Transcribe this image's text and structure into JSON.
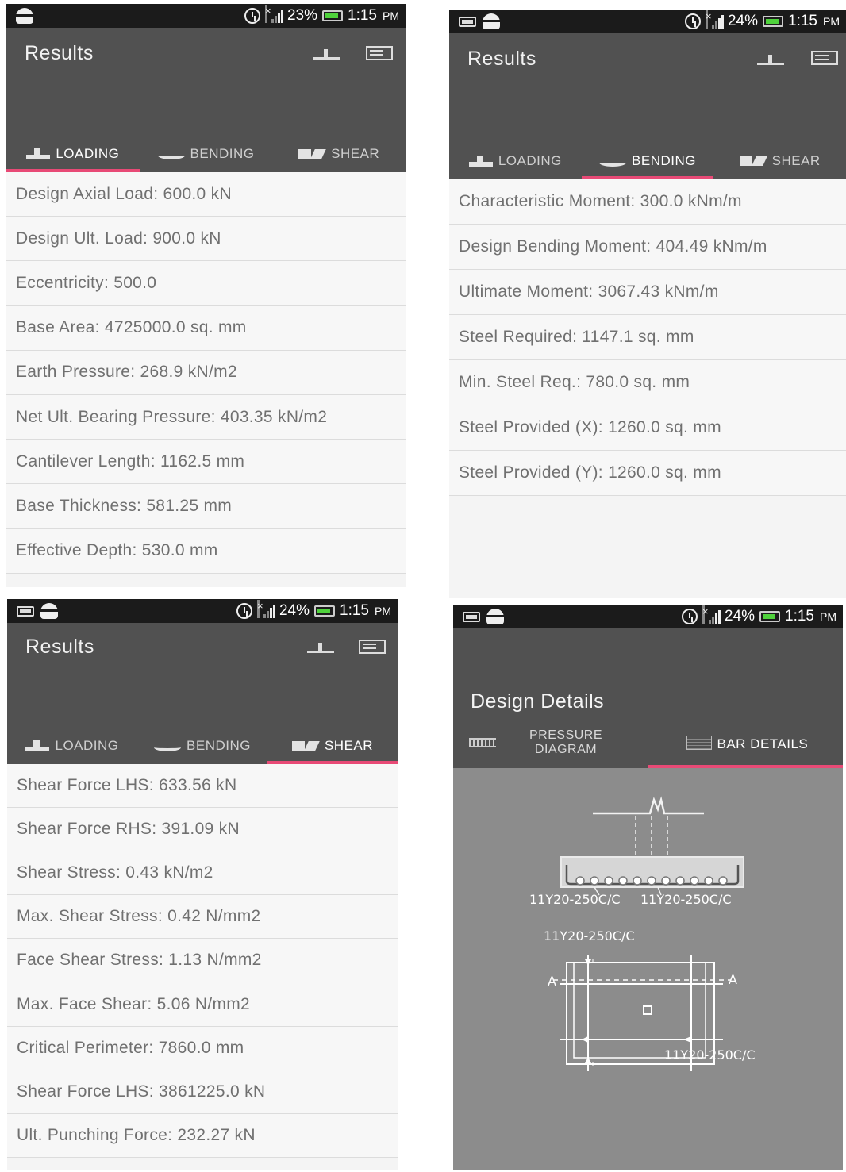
{
  "status_bars": {
    "p1": {
      "battery": "23%",
      "time": "1:15",
      "ampm": "PM"
    },
    "p2": {
      "battery": "24%",
      "time": "1:15",
      "ampm": "PM"
    },
    "p3": {
      "battery": "24%",
      "time": "1:15",
      "ampm": "PM"
    },
    "p4": {
      "battery": "24%",
      "time": "1:15",
      "ampm": "PM"
    }
  },
  "results_title": "Results",
  "tabs": {
    "loading": "LOADING",
    "bending": "BENDING",
    "shear": "SHEAR"
  },
  "loading_rows": [
    "Design Axial Load: 600.0 kN",
    "Design Ult. Load: 900.0 kN",
    "Eccentricity: 500.0",
    "Base Area: 4725000.0 sq. mm",
    "Earth Pressure: 268.9 kN/m2",
    "Net Ult. Bearing Pressure: 403.35 kN/m2",
    "Cantilever Length: 1162.5 mm",
    "Base Thickness: 581.25 mm",
    "Effective Depth: 530.0 mm"
  ],
  "bending_rows": [
    "Characteristic Moment: 300.0 kNm/m",
    "Design Bending Moment: 404.49 kNm/m",
    "Ultimate Moment: 3067.43 kNm/m",
    "Steel Required: 1147.1 sq. mm",
    "Min. Steel Req.: 780.0 sq. mm",
    "Steel Provided (X): 1260.0 sq. mm",
    "Steel Provided (Y): 1260.0 sq. mm"
  ],
  "shear_rows": [
    "Shear Force LHS: 633.56 kN",
    "Shear Force RHS: 391.09 kN",
    "Shear Stress: 0.43 kN/m2",
    "Max. Shear Stress: 0.42 N/mm2",
    "Face Shear Stress: 1.13 N/mm2",
    "Max. Face Shear: 5.06 N/mm2",
    "Critical Perimeter: 7860.0 mm",
    "Shear Force LHS: 3861225.0 kN",
    "Ult. Punching Force: 232.27 kN"
  ],
  "design_details": {
    "title": "Design Details",
    "tab_pressure_line1": "PRESSURE",
    "tab_pressure_line2": "DIAGRAM",
    "tab_bar_details": "BAR DETAILS",
    "bar_label_section_left": "11Y20-250C/C",
    "bar_label_section_right": "11Y20-250C/C",
    "bar_label_plan_top": "11Y20-250C/C",
    "bar_label_plan_bottom": "11Y20-250C/C",
    "section_marker": "A"
  },
  "icons": {
    "status": [
      "sim-icon",
      "android-icon",
      "alarm-icon",
      "signal-icon",
      "battery-icon"
    ],
    "actions": [
      "beam-icon",
      "list-check-icon"
    ],
    "tabs": [
      "loading-icon",
      "bending-icon",
      "shear-icon",
      "pressure-diagram-icon",
      "bar-details-icon"
    ]
  },
  "colors": {
    "appbar": "#515151",
    "statusbar": "#1b1b1b",
    "accent": "#e84a76",
    "list_bg": "#f7f7f7",
    "text": "#707070",
    "drawing_bg": "#8c8c8c"
  }
}
